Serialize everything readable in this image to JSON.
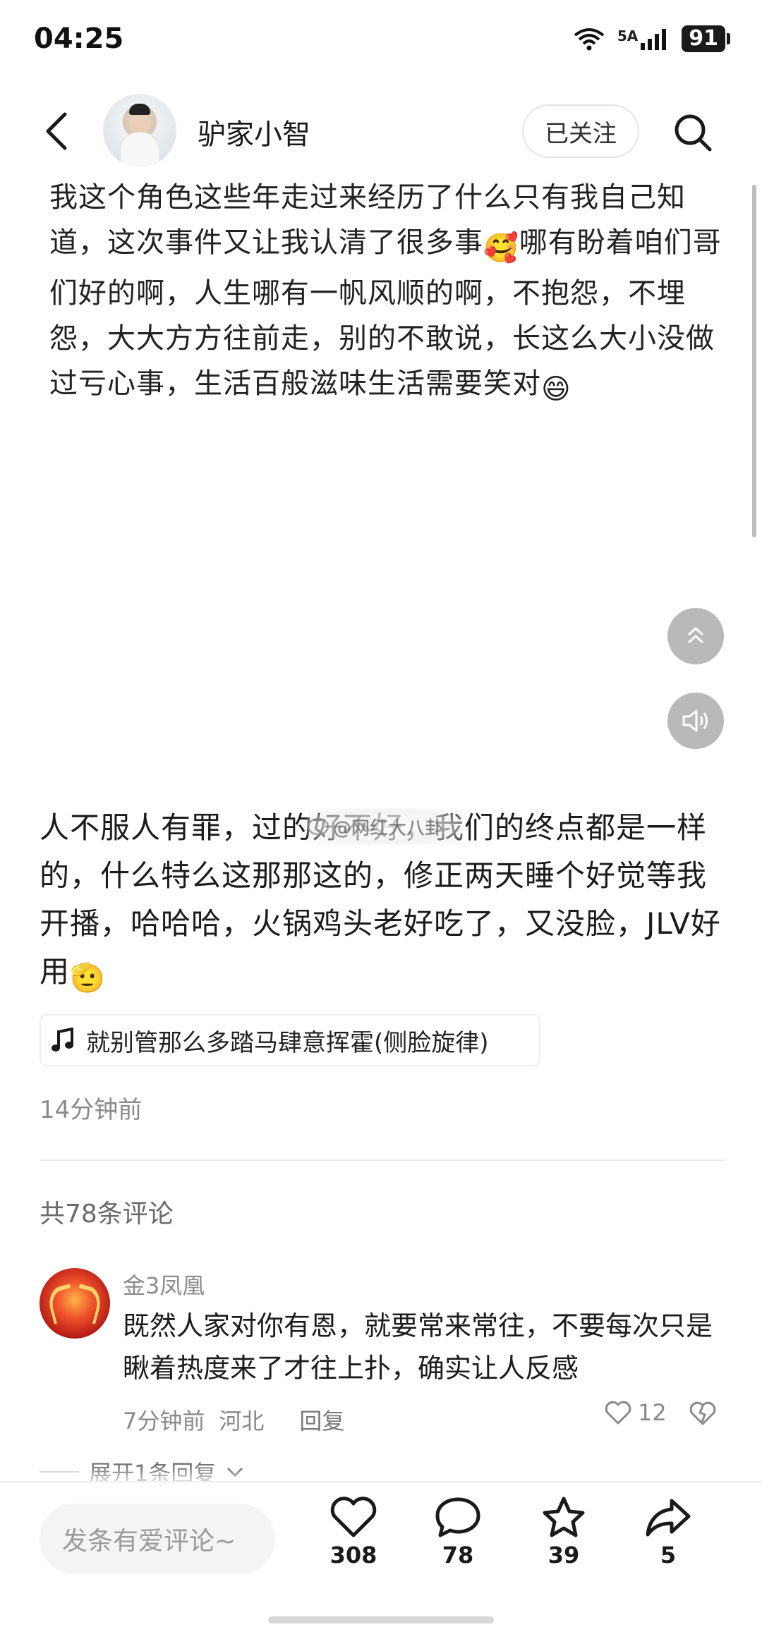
{
  "status_bar": {
    "time": "04:25",
    "network_label": "5A",
    "battery": "91",
    "icons": [
      "wifi-icon",
      "signal-icon",
      "battery-icon"
    ]
  },
  "header": {
    "username": "驴家小智",
    "follow_label": "已关注",
    "icons": [
      "back-arrow-icon",
      "search-icon"
    ]
  },
  "post": {
    "text_1_a": "我这个角色这些年走过来经历了什么只有我自己知道，这次事件又让我认清了很多事",
    "emoji_1": "🥰",
    "text_1_b": "哪有盼着咱们哥们好的啊，人生哪有一帆风顺的啊，不抱怨，不埋怨，大大方方往前走，别的不敢说，长这么大小没做过亏心事，生活百般滋味生活需要笑对",
    "emoji_2": "😄",
    "text_2": "人不服人有罪，过的好不好，我们的终点都是一样的，什么特么这那那这的，修正两天睡个好觉等我开播，哈哈哈，火锅鸡头老好吃了，又没脸，JLV好用",
    "emoji_3": "🫡",
    "watermark": "@网红大八卦",
    "music": "就别管那么多踏马肆意挥霍(侧脸旋律)",
    "time": "14分钟前"
  },
  "comments": {
    "count_label": "共78条评论",
    "items": [
      {
        "name": "金3凤凰",
        "text": "既然人家对你有恩，就要常来常往，不要每次只是瞅着热度来了才往上扑，确实让人反感",
        "time": "7分钟前",
        "location": "河北",
        "reply_label": "回复",
        "likes": "12"
      }
    ],
    "expand_label": "展开1条回复"
  },
  "bottom_bar": {
    "input_placeholder": "发条有爱评论~",
    "likes": "308",
    "comments": "78",
    "favorites": "39",
    "shares": "5"
  },
  "colors": {
    "text": "#222222",
    "secondary": "#8a8a8a",
    "float_button": "#b9b9b9"
  }
}
